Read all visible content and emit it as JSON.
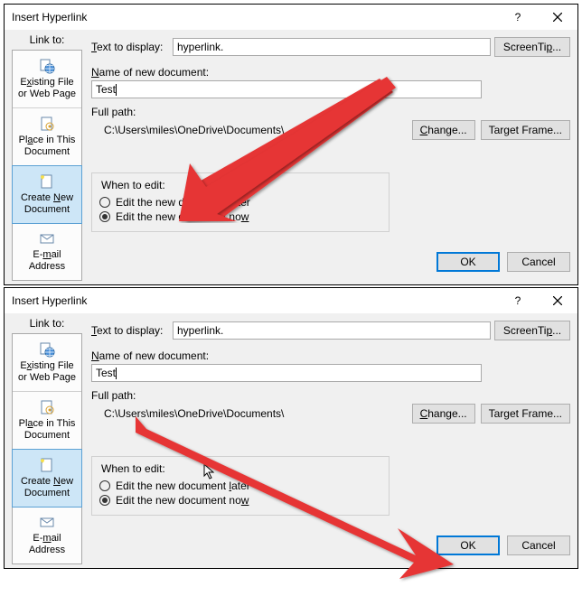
{
  "dialogs": [
    {
      "title": "Insert Hyperlink",
      "link_to_label": "Link to:",
      "text_display_label": "Text to display:",
      "text_display_value": "hyperlink.",
      "screentip_btn": "ScreenTip...",
      "name_doc_label": "Name of new document:",
      "name_doc_value": "Test",
      "fullpath_label": "Full path:",
      "fullpath_value": "C:\\Users\\miles\\OneDrive\\Documents\\",
      "change_btn": "Change...",
      "target_frame_btn": "Target Frame...",
      "whenedit_label": "When to edit:",
      "radio_later": "Edit the new document later",
      "radio_now": "Edit the new document now",
      "ok_btn": "OK",
      "cancel_btn": "Cancel",
      "options": {
        "existing": "Existing File\nor Web Page",
        "place": "Place in This\nDocument",
        "create": "Create New\nDocument",
        "email": "E-mail\nAddress"
      }
    },
    {
      "title": "Insert Hyperlink",
      "link_to_label": "Link to:",
      "text_display_label": "Text to display:",
      "text_display_value": "hyperlink.",
      "screentip_btn": "ScreenTip...",
      "name_doc_label": "Name of new document:",
      "name_doc_value": "Test",
      "fullpath_label": "Full path:",
      "fullpath_value": "C:\\Users\\miles\\OneDrive\\Documents\\",
      "change_btn": "Change...",
      "target_frame_btn": "Target Frame...",
      "whenedit_label": "When to edit:",
      "radio_later": "Edit the new document later",
      "radio_now": "Edit the new document now",
      "ok_btn": "OK",
      "cancel_btn": "Cancel",
      "options": {
        "existing": "Existing File\nor Web Page",
        "place": "Place in This\nDocument",
        "create": "Create New\nDocument",
        "email": "E-mail\nAddress"
      }
    }
  ]
}
